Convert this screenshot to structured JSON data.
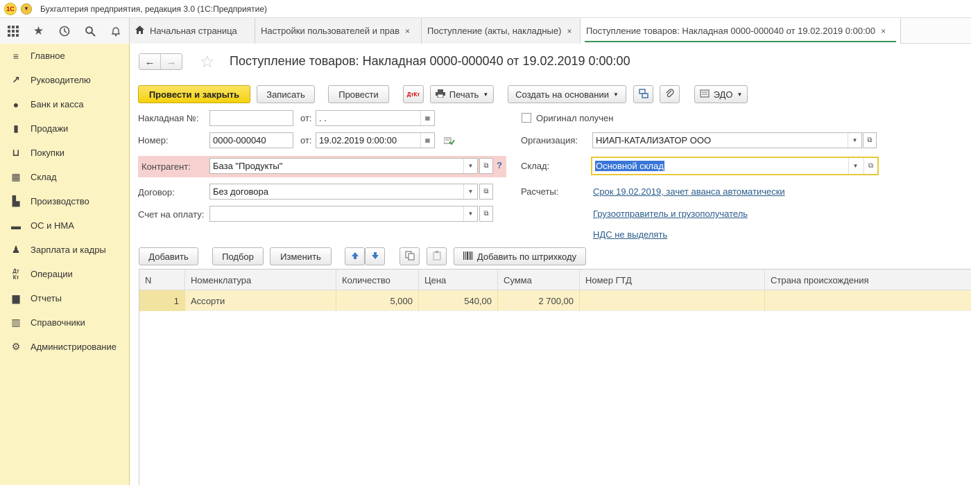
{
  "window": {
    "title": "Бухгалтерия предприятия, редакция 3.0  (1С:Предприятие)",
    "logo_text": "1С"
  },
  "tabs": [
    {
      "label": "Начальная страница",
      "closable": false
    },
    {
      "label": "Настройки пользователей и прав",
      "closable": true
    },
    {
      "label": "Поступление (акты, накладные)",
      "closable": true
    },
    {
      "label": "Поступление товаров: Накладная 0000-000040 от 19.02.2019 0:00:00",
      "closable": true,
      "active": true
    }
  ],
  "tab_close_symbol": "×",
  "sidebar": {
    "items": [
      {
        "label": "Главное",
        "icon": "menu-lines-icon"
      },
      {
        "label": "Руководителю",
        "icon": "trend-icon"
      },
      {
        "label": "Банк и касса",
        "icon": "coin-icon"
      },
      {
        "label": "Продажи",
        "icon": "bag-icon"
      },
      {
        "label": "Покупки",
        "icon": "cart-icon"
      },
      {
        "label": "Склад",
        "icon": "warehouse-icon"
      },
      {
        "label": "Производство",
        "icon": "factory-icon"
      },
      {
        "label": "ОС и НМА",
        "icon": "truck-icon"
      },
      {
        "label": "Зарплата и кадры",
        "icon": "person-icon"
      },
      {
        "label": "Операции",
        "icon": "dt-kt-icon"
      },
      {
        "label": "Отчеты",
        "icon": "bar-chart-icon"
      },
      {
        "label": "Справочники",
        "icon": "books-icon"
      },
      {
        "label": "Администрирование",
        "icon": "gear-icon"
      }
    ]
  },
  "document": {
    "title": "Поступление товаров: Накладная 0000-000040 от 19.02.2019 0:00:00"
  },
  "toolbar": {
    "post_close": "Провести и закрыть",
    "save": "Записать",
    "post": "Провести",
    "dtkt": "ДтКт",
    "print": "Печать",
    "create_based": "Создать на основании",
    "edo": "ЭДО"
  },
  "form": {
    "invoice_no_label": "Накладная №:",
    "invoice_no_value": "",
    "from_label": "от:",
    "invoice_date_value": " .  .",
    "number_label": "Номер:",
    "number_value": "0000-000040",
    "number_date_value": "19.02.2019  0:00:00",
    "counterparty_label": "Контрагент:",
    "counterparty_value": "База \"Продукты\"",
    "help_symbol": "?",
    "contract_label": "Договор:",
    "contract_value": "Без договора",
    "invoice_pay_label": "Счет на оплату:",
    "invoice_pay_value": "",
    "original_received_label": "Оригинал получен",
    "organization_label": "Организация:",
    "organization_value": "НИАП-КАТАЛИЗАТОР ООО",
    "warehouse_label": "Склад:",
    "warehouse_value": "Основной склад",
    "settlements_label": "Расчеты:",
    "settlements_link": "Срок 19.02.2019, зачет аванса автоматически",
    "shipper_link": "Грузоотправитель и грузополучатель",
    "vat_link": "НДС не выделять"
  },
  "table_toolbar": {
    "add": "Добавить",
    "pick": "Подбор",
    "change": "Изменить",
    "barcode": "Добавить по штрихкоду"
  },
  "table": {
    "columns": [
      "N",
      "Номенклатура",
      "Количество",
      "Цена",
      "Сумма",
      "Номер ГТД",
      "Страна происхождения"
    ],
    "rows": [
      {
        "n": "1",
        "item": "Ассорти",
        "qty": "5,000",
        "price": "540,00",
        "sum": "2 700,00",
        "gtd": "",
        "country": ""
      }
    ]
  }
}
